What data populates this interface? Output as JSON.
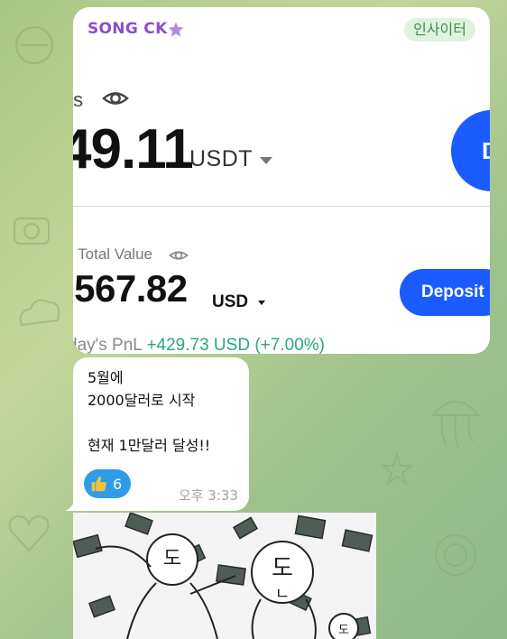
{
  "chat": {
    "background_color": "#b6cf8e",
    "messages": [
      {
        "sender": "SONG CK",
        "sender_color": "#8b4fc9",
        "sender_icon": "star-icon",
        "tag": "인사이터",
        "screenshot": {
          "label_partial": "ts",
          "amount": "49.11",
          "unit": "USDT",
          "round_button_label": "D",
          "total_label": ". Total Value",
          "total_amount": ",567.82",
          "total_unit": "USD",
          "deposit_label": "Deposit",
          "pnl_label": "day's PnL",
          "pnl_value": "+429.73 USD (+7.00%)",
          "accent_color": "#1a5cff",
          "pnl_color": "#29a877"
        }
      },
      {
        "text": "5월에\n2000달러로 시작\n\n현재 1만달러 달성!!",
        "reaction": {
          "icon": "thumbs-up-icon",
          "count": "6"
        },
        "time": "오후 3:33"
      },
      {
        "image": "meme-sticker",
        "image_caption_letters": [
          "도",
          "ㄴ"
        ]
      }
    ]
  }
}
